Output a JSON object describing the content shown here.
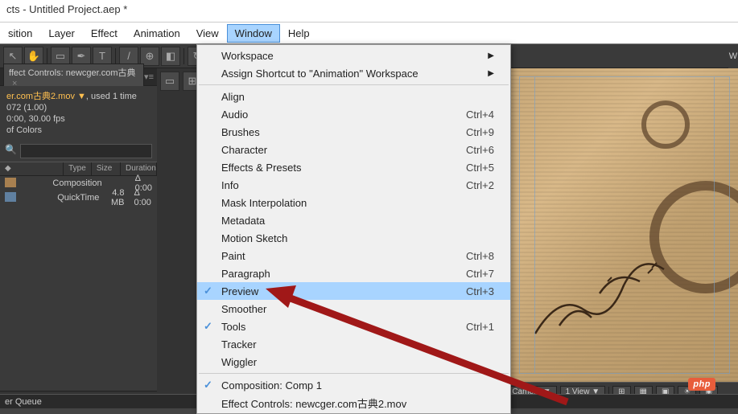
{
  "titlebar": {
    "text": "cts - Untitled Project.aep *"
  },
  "menubar": {
    "items": [
      "sition",
      "Layer",
      "Effect",
      "Animation",
      "View",
      "Window",
      "Help"
    ],
    "active_index": 5
  },
  "toolbar": {
    "icons": [
      "arrow",
      "hand",
      "rect",
      "pen",
      "text",
      "brush",
      "stamp",
      "eraser",
      "rotate",
      "pin",
      "grid"
    ]
  },
  "panel": {
    "tab_label": "ffect Controls: newcger.com古典",
    "project_info": {
      "filename": "er.com古典2.mov ▼",
      "used_text": ", used 1 time",
      "res": "072 (1.00)",
      "fps": "0:00, 30.00 fps",
      "colors": " of Colors"
    },
    "headers": {
      "name_icon": "",
      "type": "Type",
      "size": "Size",
      "duration": "Duration"
    },
    "rows": [
      {
        "name": "",
        "type": "Composition",
        "size": "",
        "duration": "Δ 0:00"
      },
      {
        "name": "",
        "type": "QuickTime",
        "size": "4.8 MB",
        "duration": "Δ 0:00"
      }
    ]
  },
  "dropdown": {
    "sections": [
      [
        {
          "label": "Workspace",
          "arrow": true
        },
        {
          "label": "Assign Shortcut to \"Animation\" Workspace",
          "arrow": true
        }
      ],
      [
        {
          "label": "Align"
        },
        {
          "label": "Audio",
          "shortcut": "Ctrl+4"
        },
        {
          "label": "Brushes",
          "shortcut": "Ctrl+9"
        },
        {
          "label": "Character",
          "shortcut": "Ctrl+6"
        },
        {
          "label": "Effects & Presets",
          "shortcut": "Ctrl+5"
        },
        {
          "label": "Info",
          "shortcut": "Ctrl+2"
        },
        {
          "label": "Mask Interpolation"
        },
        {
          "label": "Metadata"
        },
        {
          "label": "Motion Sketch"
        },
        {
          "label": "Paint",
          "shortcut": "Ctrl+8"
        },
        {
          "label": "Paragraph",
          "shortcut": "Ctrl+7"
        },
        {
          "label": "Preview",
          "shortcut": "Ctrl+3",
          "checked": true,
          "highlighted": true
        },
        {
          "label": "Smoother"
        },
        {
          "label": "Tools",
          "shortcut": "Ctrl+1",
          "checked": true
        },
        {
          "label": "Tracker"
        },
        {
          "label": "Wiggler"
        }
      ],
      [
        {
          "label": "Composition: Comp 1",
          "checked": true
        },
        {
          "label": "Effect Controls: newcger.com古典2.mov"
        }
      ]
    ]
  },
  "viewer_toolbar": {
    "camera": "e Camera ▼",
    "view": "1 View ▼"
  },
  "footer": {
    "label": "er Queue"
  },
  "right_edge": {
    "label": "W"
  },
  "php_logo": {
    "text": "php"
  }
}
